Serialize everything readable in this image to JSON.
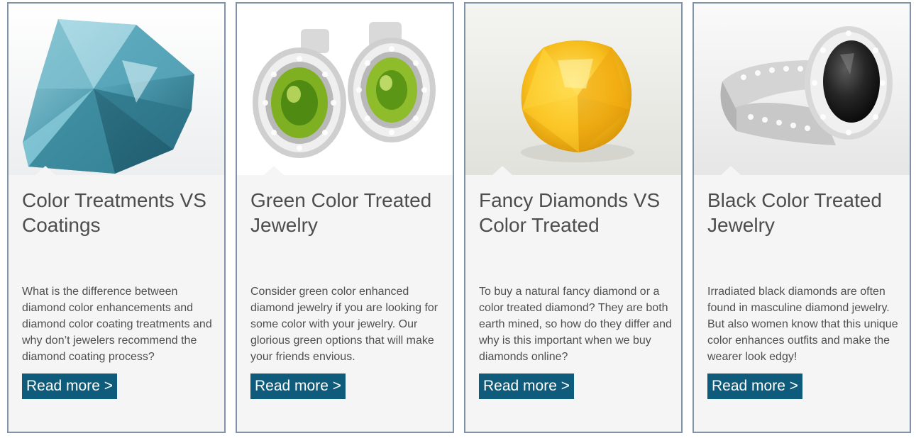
{
  "cards": [
    {
      "title": "Color Treatments VS Coatings",
      "description": "What is the difference between diamond color enhancements and diamond color coating treatments and why don’t jewelers recommend the diamond coating process?",
      "button_label": "Read more >",
      "image_icon": "blue-pear-diamond-icon"
    },
    {
      "title": "Green Color Treated Jewelry",
      "description": "Consider green color enhanced diamond jewelry if you are looking for some color with your jewelry. Our glorious green options that will make your friends envious.",
      "button_label": "Read more >",
      "image_icon": "green-diamond-earrings-icon"
    },
    {
      "title": "Fancy Diamonds VS Color Treated",
      "description": "To buy a natural fancy diamond or a color treated diamond? They are both earth mined, so how do they differ and why is this important when we buy diamonds online?",
      "button_label": "Read more >",
      "image_icon": "yellow-cushion-diamond-icon"
    },
    {
      "title": "Black Color Treated Jewelry",
      "description": "Irradiated black diamonds are often found in masculine diamond jewelry. But also women know that this unique color enhances outfits and make the wearer look edgy!",
      "button_label": "Read more >",
      "image_icon": "black-diamond-ring-icon"
    }
  ],
  "colors": {
    "button_bg": "#0e5b7c",
    "card_border": "#8193a8",
    "card_bg": "#f5f5f5",
    "title_text": "#4d4d4d"
  }
}
